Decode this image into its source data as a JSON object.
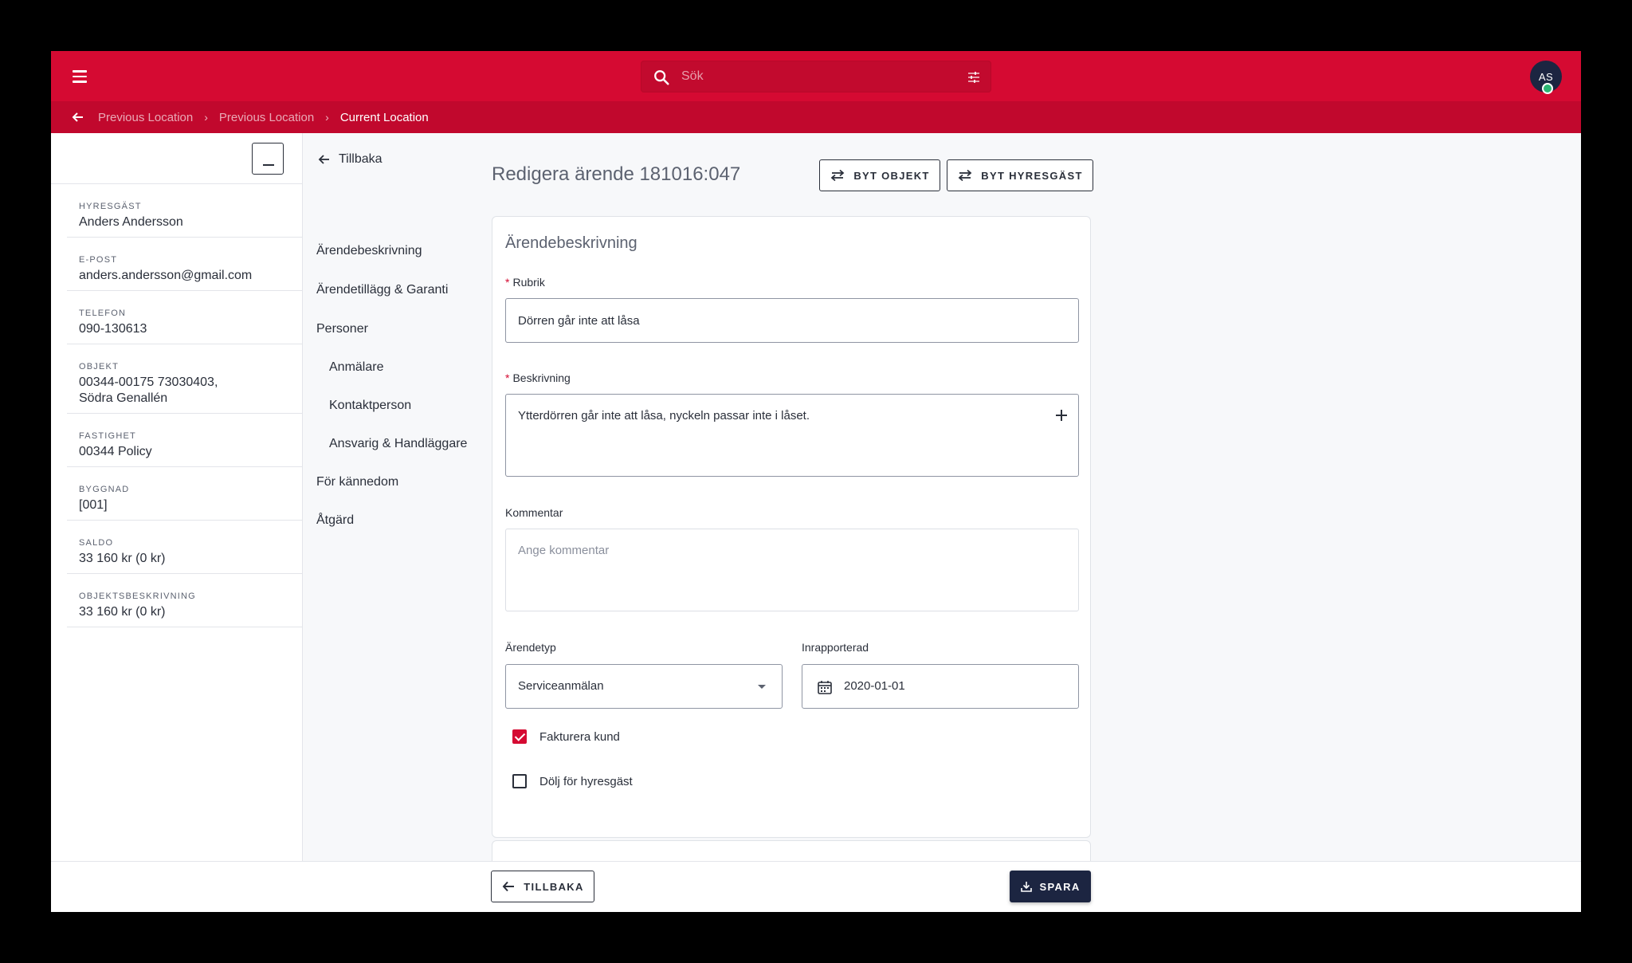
{
  "topbar": {
    "search_placeholder": "Sök",
    "avatar_initials": "AS"
  },
  "breadcrumb": {
    "items": [
      "Previous Location",
      "Previous Location",
      "Current Location"
    ]
  },
  "tenant_info": [
    {
      "label": "HYRESGÄST",
      "value": "Anders Andersson"
    },
    {
      "label": "E-POST",
      "value": "anders.andersson@gmail.com"
    },
    {
      "label": "TELEFON",
      "value": "090-130613"
    },
    {
      "label": "OBJEKT",
      "value": "00344-00175 73030403,",
      "value2": "Södra Genallén"
    },
    {
      "label": "FASTIGHET",
      "value": "00344 Policy"
    },
    {
      "label": "BYGGNAD",
      "value": "[001]"
    },
    {
      "label": "SALDO",
      "value": "33 160 kr (0 kr)"
    },
    {
      "label": "OBJEKTSBESKRIVNING",
      "value": "33 160 kr (0 kr)"
    }
  ],
  "nav": {
    "back_label": "Tillbaka",
    "items": [
      "Ärendebeskrivning",
      "Ärendetillägg & Garanti",
      "Personer",
      "Anmälare",
      "Kontaktperson",
      "Ansvarig & Handläggare",
      "För kännedom",
      "Åtgärd"
    ]
  },
  "main": {
    "title": "Redigera ärende 181016:047",
    "switch_object_label": "BYT OBJEKT",
    "switch_tenant_label": "BYT HYRESGÄST",
    "card_title": "Ärendebeskrivning",
    "rubrik_label": "Rubrik",
    "rubrik_value": "Dörren går inte att låsa",
    "beskrivning_label": "Beskrivning",
    "beskrivning_value": "Ytterdörren går inte att låsa, nyckeln passar inte i låset.",
    "kommentar_label": "Kommentar",
    "kommentar_placeholder": "Ange kommentar",
    "arendetyp_label": "Ärendetyp",
    "arendetyp_value": "Serviceanmälan",
    "inrapporterad_label": "Inrapporterad",
    "inrapporterad_value": "2020-01-01",
    "fakturera_label": "Fakturera kund",
    "fakturera_checked": true,
    "dolj_label": "Dölj för hyresgäst",
    "dolj_checked": false,
    "required_mark": "*"
  },
  "footer": {
    "back_label": "TILLBAKA",
    "save_label": "SPARA"
  },
  "colors": {
    "brand_red": "#d50a32",
    "navy": "#1c2541"
  }
}
